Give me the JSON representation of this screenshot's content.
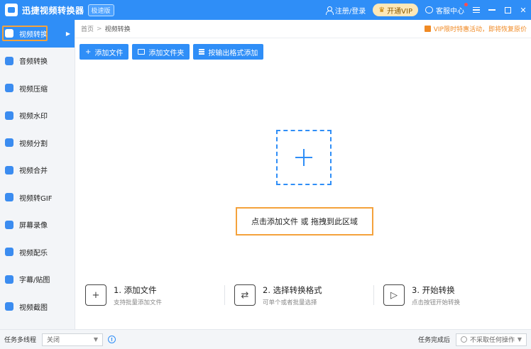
{
  "titlebar": {
    "title": "迅捷视频转换器",
    "edition": "极速版",
    "login": "注册/登录",
    "vip": "开通VIP",
    "service": "客服中心"
  },
  "sidebar": {
    "items": [
      {
        "label": "视频转换",
        "icon": "video-convert-icon"
      },
      {
        "label": "音频转换",
        "icon": "audio-convert-icon"
      },
      {
        "label": "视频压缩",
        "icon": "video-compress-icon"
      },
      {
        "label": "视频水印",
        "icon": "video-watermark-icon"
      },
      {
        "label": "视频分割",
        "icon": "video-split-icon"
      },
      {
        "label": "视频合并",
        "icon": "video-merge-icon"
      },
      {
        "label": "视频转GIF",
        "icon": "video-gif-icon"
      },
      {
        "label": "屏幕录像",
        "icon": "screen-record-icon"
      },
      {
        "label": "视频配乐",
        "icon": "video-music-icon"
      },
      {
        "label": "字幕/贴图",
        "icon": "subtitle-sticker-icon"
      },
      {
        "label": "视频截图",
        "icon": "video-screenshot-icon"
      }
    ]
  },
  "breadcrumb": {
    "home": "首页",
    "sep": ">",
    "current": "视频转换"
  },
  "promo": "VIP限时特惠活动，即将恢复原价",
  "toolbar": {
    "add_file": "添加文件",
    "add_folder": "添加文件夹",
    "add_by_format": "按输出格式添加"
  },
  "dropzone": {
    "hint": "点击添加文件 或 拖拽到此区域"
  },
  "steps": [
    {
      "title": "1. 添加文件",
      "desc": "支持批量添加文件"
    },
    {
      "title": "2. 选择转换格式",
      "desc": "可单个或者批量选择"
    },
    {
      "title": "3. 开始转换",
      "desc": "点击按钮开始转换"
    }
  ],
  "statusbar": {
    "multithread_label": "任务多线程",
    "multithread_value": "关闭",
    "after_complete_label": "任务完成后",
    "after_complete_value": "不采取任何操作"
  },
  "colors": {
    "accent": "#2f8ef7",
    "highlight": "#f4a23c",
    "promo": "#f08a24"
  }
}
